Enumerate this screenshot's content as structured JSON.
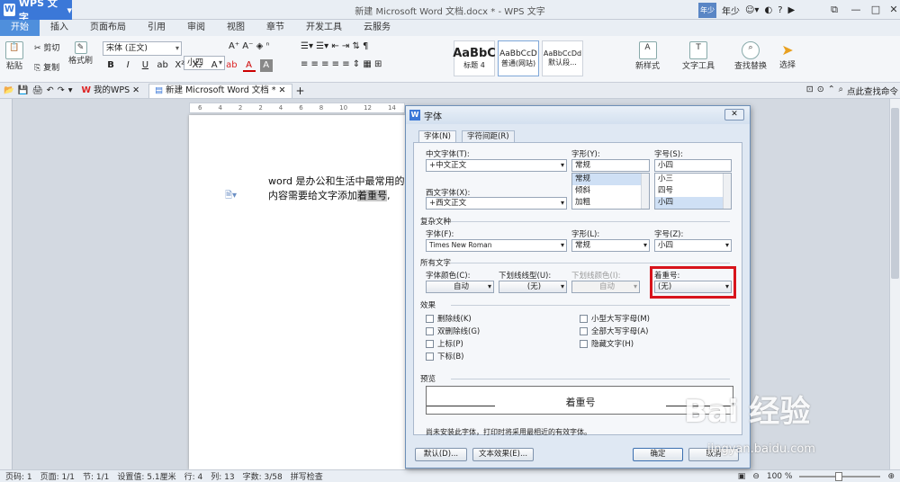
{
  "app": {
    "name": "WPS 文字",
    "window_title": "新建 Microsoft Word 文档.docx * - WPS 文字",
    "user": "年少",
    "avatar_text": "年少"
  },
  "ribbon_tabs": [
    "开始",
    "插入",
    "页面布局",
    "引用",
    "审阅",
    "视图",
    "章节",
    "开发工具",
    "云服务"
  ],
  "ribbon": {
    "cut": "剪切",
    "paste": "粘贴",
    "copy": "复制",
    "format_painter": "格式刷",
    "font_name": "宋体 (正文)",
    "font_size": "小四",
    "styles": [
      {
        "sample": "AaBbC",
        "name": "标题 4"
      },
      {
        "sample": "AaBbCcD",
        "name": "普通(网站)"
      },
      {
        "sample": "AaBbCcDd",
        "name": "默认段..."
      }
    ],
    "new_style": "新样式",
    "text_tools": "文字工具",
    "find_replace": "查找替换",
    "select": "选择"
  },
  "quickbar": {
    "tab1": "我的WPS",
    "tab2": "新建 Microsoft Word 文档 *",
    "help": "点此查找命令"
  },
  "ruler_marks": [
    "6",
    "4",
    "2",
    "2",
    "4",
    "6",
    "8",
    "10",
    "12",
    "14"
  ],
  "document": {
    "line1": "word 是办公和生活中最常用的",
    "line2_pre": "内容需要给文字添加",
    "line2_hl": "着重号",
    "line2_post": ","
  },
  "statusbar": [
    "页码: 1",
    "页面: 1/1",
    "节: 1/1",
    "设置值: 5.1厘米",
    "行: 4",
    "列: 13",
    "字数: 3/58",
    "拼写检查"
  ],
  "zoom": "100 %",
  "dialog": {
    "title": "字体",
    "tabs": [
      "字体(N)",
      "字符间距(R)"
    ],
    "cn_font_label": "中文字体(T):",
    "cn_font_value": "+中文正文",
    "style_label": "字形(Y):",
    "style_value": "常规",
    "style_list": [
      "常规",
      "倾斜",
      "加粗"
    ],
    "size_label": "字号(S):",
    "size_value": "小四",
    "size_list": [
      "小三",
      "四号",
      "小四"
    ],
    "west_font_label": "西文字体(X):",
    "west_font_value": "+西文正文",
    "complex_section": "复杂文种",
    "cx_font_label": "字体(F):",
    "cx_font_value": "Times New Roman",
    "cx_style_label": "字形(L):",
    "cx_style_value": "常规",
    "cx_size_label": "字号(Z):",
    "cx_size_value": "小四",
    "all_text_section": "所有文字",
    "color_label": "字体颜色(C):",
    "color_value": "自动",
    "underline_label": "下划线线型(U):",
    "underline_value": "(无)",
    "ul_color_label": "下划线颜色(I):",
    "ul_color_value": "自动",
    "emphasis_label": "着重号:",
    "emphasis_value": "(无)",
    "effects_section": "效果",
    "effects_left": [
      "删除线(K)",
      "双删除线(G)",
      "上标(P)",
      "下标(B)"
    ],
    "effects_right": [
      "小型大写字母(M)",
      "全部大写字母(A)",
      "隐藏文字(H)"
    ],
    "preview_section": "预览",
    "preview_text": "着重号",
    "note": "尚未安装此字体，打印时将采用最相近的有效字体。",
    "btn_default": "默认(D)...",
    "btn_effects": "文本效果(E)...",
    "btn_ok": "确定",
    "btn_cancel": "取消"
  },
  "watermark": {
    "brand": "Bai 经验",
    "url": "jingyan.baidu.com"
  }
}
